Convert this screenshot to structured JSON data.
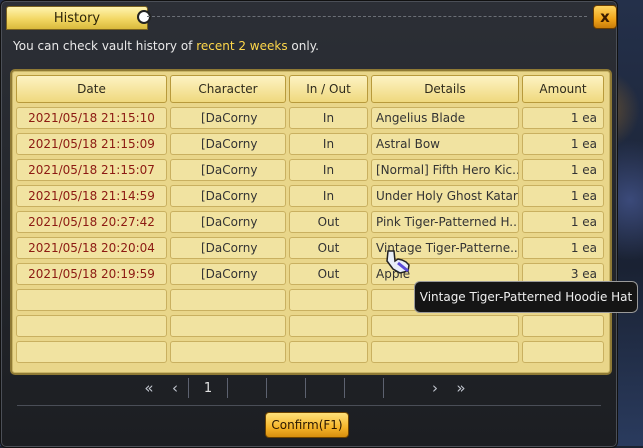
{
  "window": {
    "title": "History",
    "close_label": "x",
    "notice": {
      "prefix": "You can check vault history of ",
      "highlight": "recent 2 weeks",
      "suffix": " only."
    }
  },
  "table": {
    "headers": [
      "Date",
      "Character",
      "In / Out",
      "Details",
      "Amount"
    ],
    "rows": [
      {
        "date": "2021/05/18 21:15:10",
        "character": "[DaCorny",
        "io": "In",
        "details": "Angelius Blade",
        "amount": "1 ea"
      },
      {
        "date": "2021/05/18 21:15:09",
        "character": "[DaCorny",
        "io": "In",
        "details": "Astral Bow",
        "amount": "1 ea"
      },
      {
        "date": "2021/05/18 21:15:07",
        "character": "[DaCorny",
        "io": "In",
        "details": "[Normal] Fifth Hero Kic...",
        "amount": "1 ea"
      },
      {
        "date": "2021/05/18 21:14:59",
        "character": "[DaCorny",
        "io": "In",
        "details": "Under Holy Ghost Katar",
        "amount": "1 ea"
      },
      {
        "date": "2021/05/18 20:27:42",
        "character": "[DaCorny",
        "io": "Out",
        "details": "Pink Tiger-Patterned H...",
        "amount": "1 ea"
      },
      {
        "date": "2021/05/18 20:20:04",
        "character": "[DaCorny",
        "io": "Out",
        "details": "Vintage Tiger-Patterne...",
        "amount": "1 ea"
      },
      {
        "date": "2021/05/18 20:19:59",
        "character": "[DaCorny",
        "io": "Out",
        "details": "Apple",
        "amount": "3 ea"
      },
      {
        "date": "",
        "character": "",
        "io": "",
        "details": "",
        "amount": ""
      },
      {
        "date": "",
        "character": "",
        "io": "",
        "details": "",
        "amount": ""
      },
      {
        "date": "",
        "character": "",
        "io": "",
        "details": "",
        "amount": ""
      }
    ]
  },
  "pager": {
    "first_icon": "double-chevron-left-icon",
    "prev_icon": "chevron-left-icon",
    "next_icon": "chevron-right-icon",
    "last_icon": "double-chevron-right-icon",
    "current_page": "1"
  },
  "tooltip": {
    "text": "Vintage Tiger-Patterned Hoodie Hat"
  },
  "confirm_label": "Confirm(F1)",
  "colors": {
    "accent_gold": "#f2d764",
    "panel": "#e9d68a",
    "date_text": "#8c1a12",
    "highlight": "#ffd84a"
  }
}
